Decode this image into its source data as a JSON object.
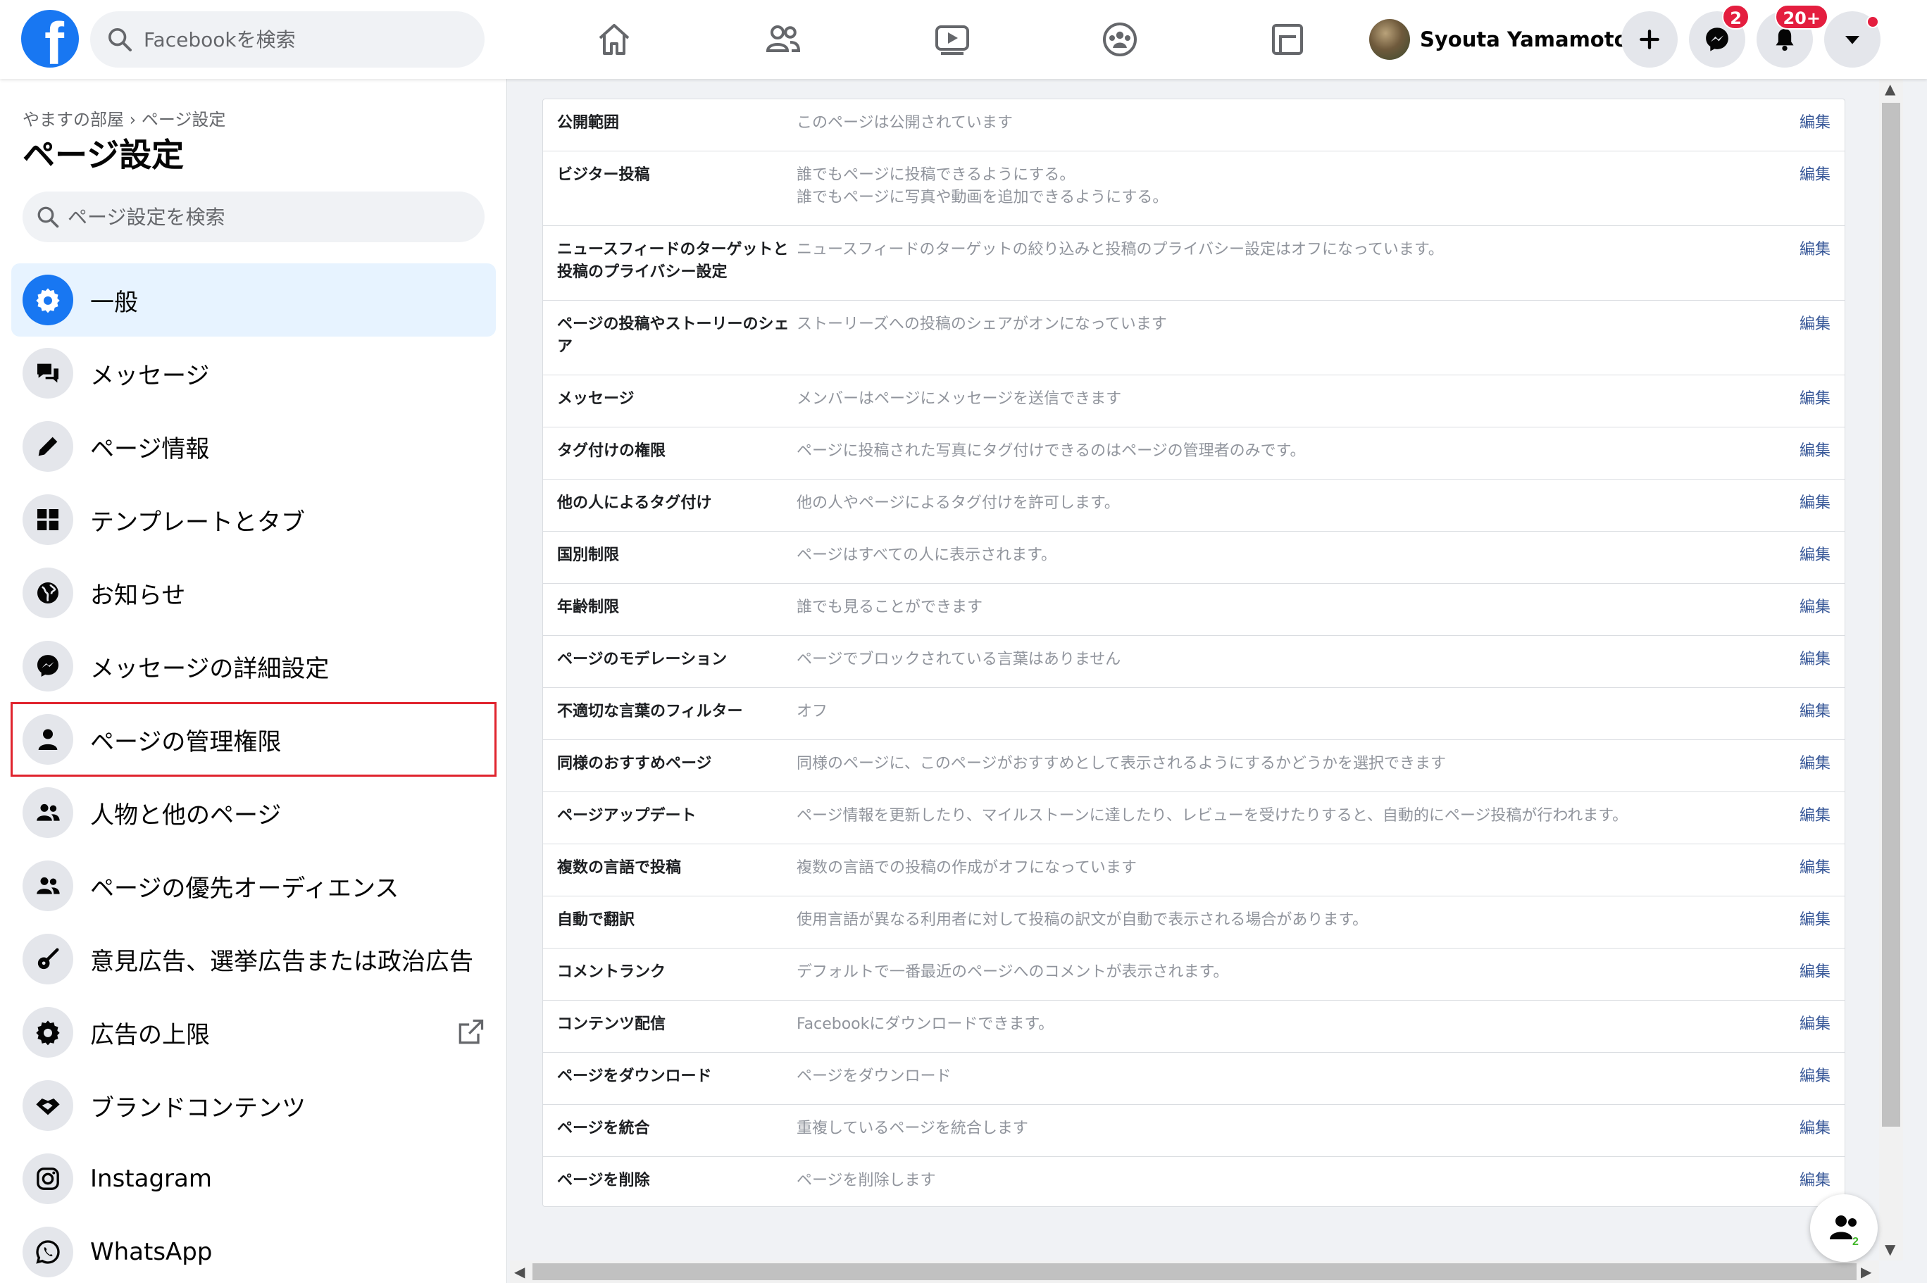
{
  "topbar": {
    "logo_letter": "f",
    "search_placeholder": "Facebookを検索",
    "profile_name": "Syouta Yamamoto",
    "messenger_badge": "2",
    "notifications_badge": "20+"
  },
  "sidebar": {
    "breadcrumb": "やますの部屋 › ページ設定",
    "title": "ページ設定",
    "search_placeholder": "ページ設定を検索",
    "items": [
      {
        "label": "一般",
        "icon": "gear-icon"
      },
      {
        "label": "メッセージ",
        "icon": "chat-bubbles-icon"
      },
      {
        "label": "ページ情報",
        "icon": "pencil-icon"
      },
      {
        "label": "テンプレートとタブ",
        "icon": "grid-icon"
      },
      {
        "label": "お知らせ",
        "icon": "globe-icon"
      },
      {
        "label": "メッセージの詳細設定",
        "icon": "messenger-icon"
      },
      {
        "label": "ページの管理権限",
        "icon": "person-icon"
      },
      {
        "label": "人物と他のページ",
        "icon": "people-icon"
      },
      {
        "label": "ページの優先オーディエンス",
        "icon": "people-icon"
      },
      {
        "label": "意見広告、選挙広告または政治広告",
        "icon": "guitar-icon"
      },
      {
        "label": "広告の上限",
        "icon": "gear-icon"
      },
      {
        "label": "ブランドコンテンツ",
        "icon": "handshake-icon"
      },
      {
        "label": "Instagram",
        "icon": "instagram-icon"
      },
      {
        "label": "WhatsApp",
        "icon": "whatsapp-icon"
      }
    ]
  },
  "settings": {
    "edit_label": "編集",
    "rows": [
      {
        "label": "公開範囲",
        "desc": "このページは公開されています"
      },
      {
        "label": "ビジター投稿",
        "desc": "誰でもページに投稿できるようにする。\n誰でもページに写真や動画を追加できるようにする。"
      },
      {
        "label": "ニュースフィードのターゲットと投稿のプライバシー設定",
        "desc": "ニュースフィードのターゲットの絞り込みと投稿のプライバシー設定はオフになっています。"
      },
      {
        "label": "ページの投稿やストーリーのシェア",
        "desc": "ストーリーズへの投稿のシェアがオンになっています"
      },
      {
        "label": "メッセージ",
        "desc": "メンバーはページにメッセージを送信できます"
      },
      {
        "label": "タグ付けの権限",
        "desc": "ページに投稿された写真にタグ付けできるのはページの管理者のみです。"
      },
      {
        "label": "他の人によるタグ付け",
        "desc": "他の人やページによるタグ付けを許可します。"
      },
      {
        "label": "国別制限",
        "desc": "ページはすべての人に表示されます。"
      },
      {
        "label": "年齢制限",
        "desc": "誰でも見ることができます"
      },
      {
        "label": "ページのモデレーション",
        "desc": "ページでブロックされている言葉はありません"
      },
      {
        "label": "不適切な言葉のフィルター",
        "desc": "オフ"
      },
      {
        "label": "同様のおすすめページ",
        "desc": "同様のページに、このページがおすすめとして表示されるようにするかどうかを選択できます"
      },
      {
        "label": "ページアップデート",
        "desc": "ページ情報を更新したり、マイルストーンに達したり、レビューを受けたりすると、自動的にページ投稿が行われます。"
      },
      {
        "label": "複数の言語で投稿",
        "desc": "複数の言語での投稿の作成がオフになっています"
      },
      {
        "label": "自動で翻訳",
        "desc": "使用言語が異なる利用者に対して投稿の訳文が自動で表示される場合があります。"
      },
      {
        "label": "コメントランク",
        "desc": "デフォルトで一番最近のページへのコメントが表示されます。"
      },
      {
        "label": "コンテンツ配信",
        "desc": "Facebookにダウンロードできます。"
      },
      {
        "label": "ページをダウンロード",
        "desc": "ページをダウンロード"
      },
      {
        "label": "ページを統合",
        "desc": "重複しているページを統合します"
      },
      {
        "label": "ページを削除",
        "desc": "ページを削除します"
      }
    ]
  },
  "floating_button": {
    "count": "2"
  },
  "colors": {
    "brand": "#1877f2",
    "badge": "#e41e3f",
    "highlight_outline": "#e0242e",
    "link": "#385898"
  }
}
